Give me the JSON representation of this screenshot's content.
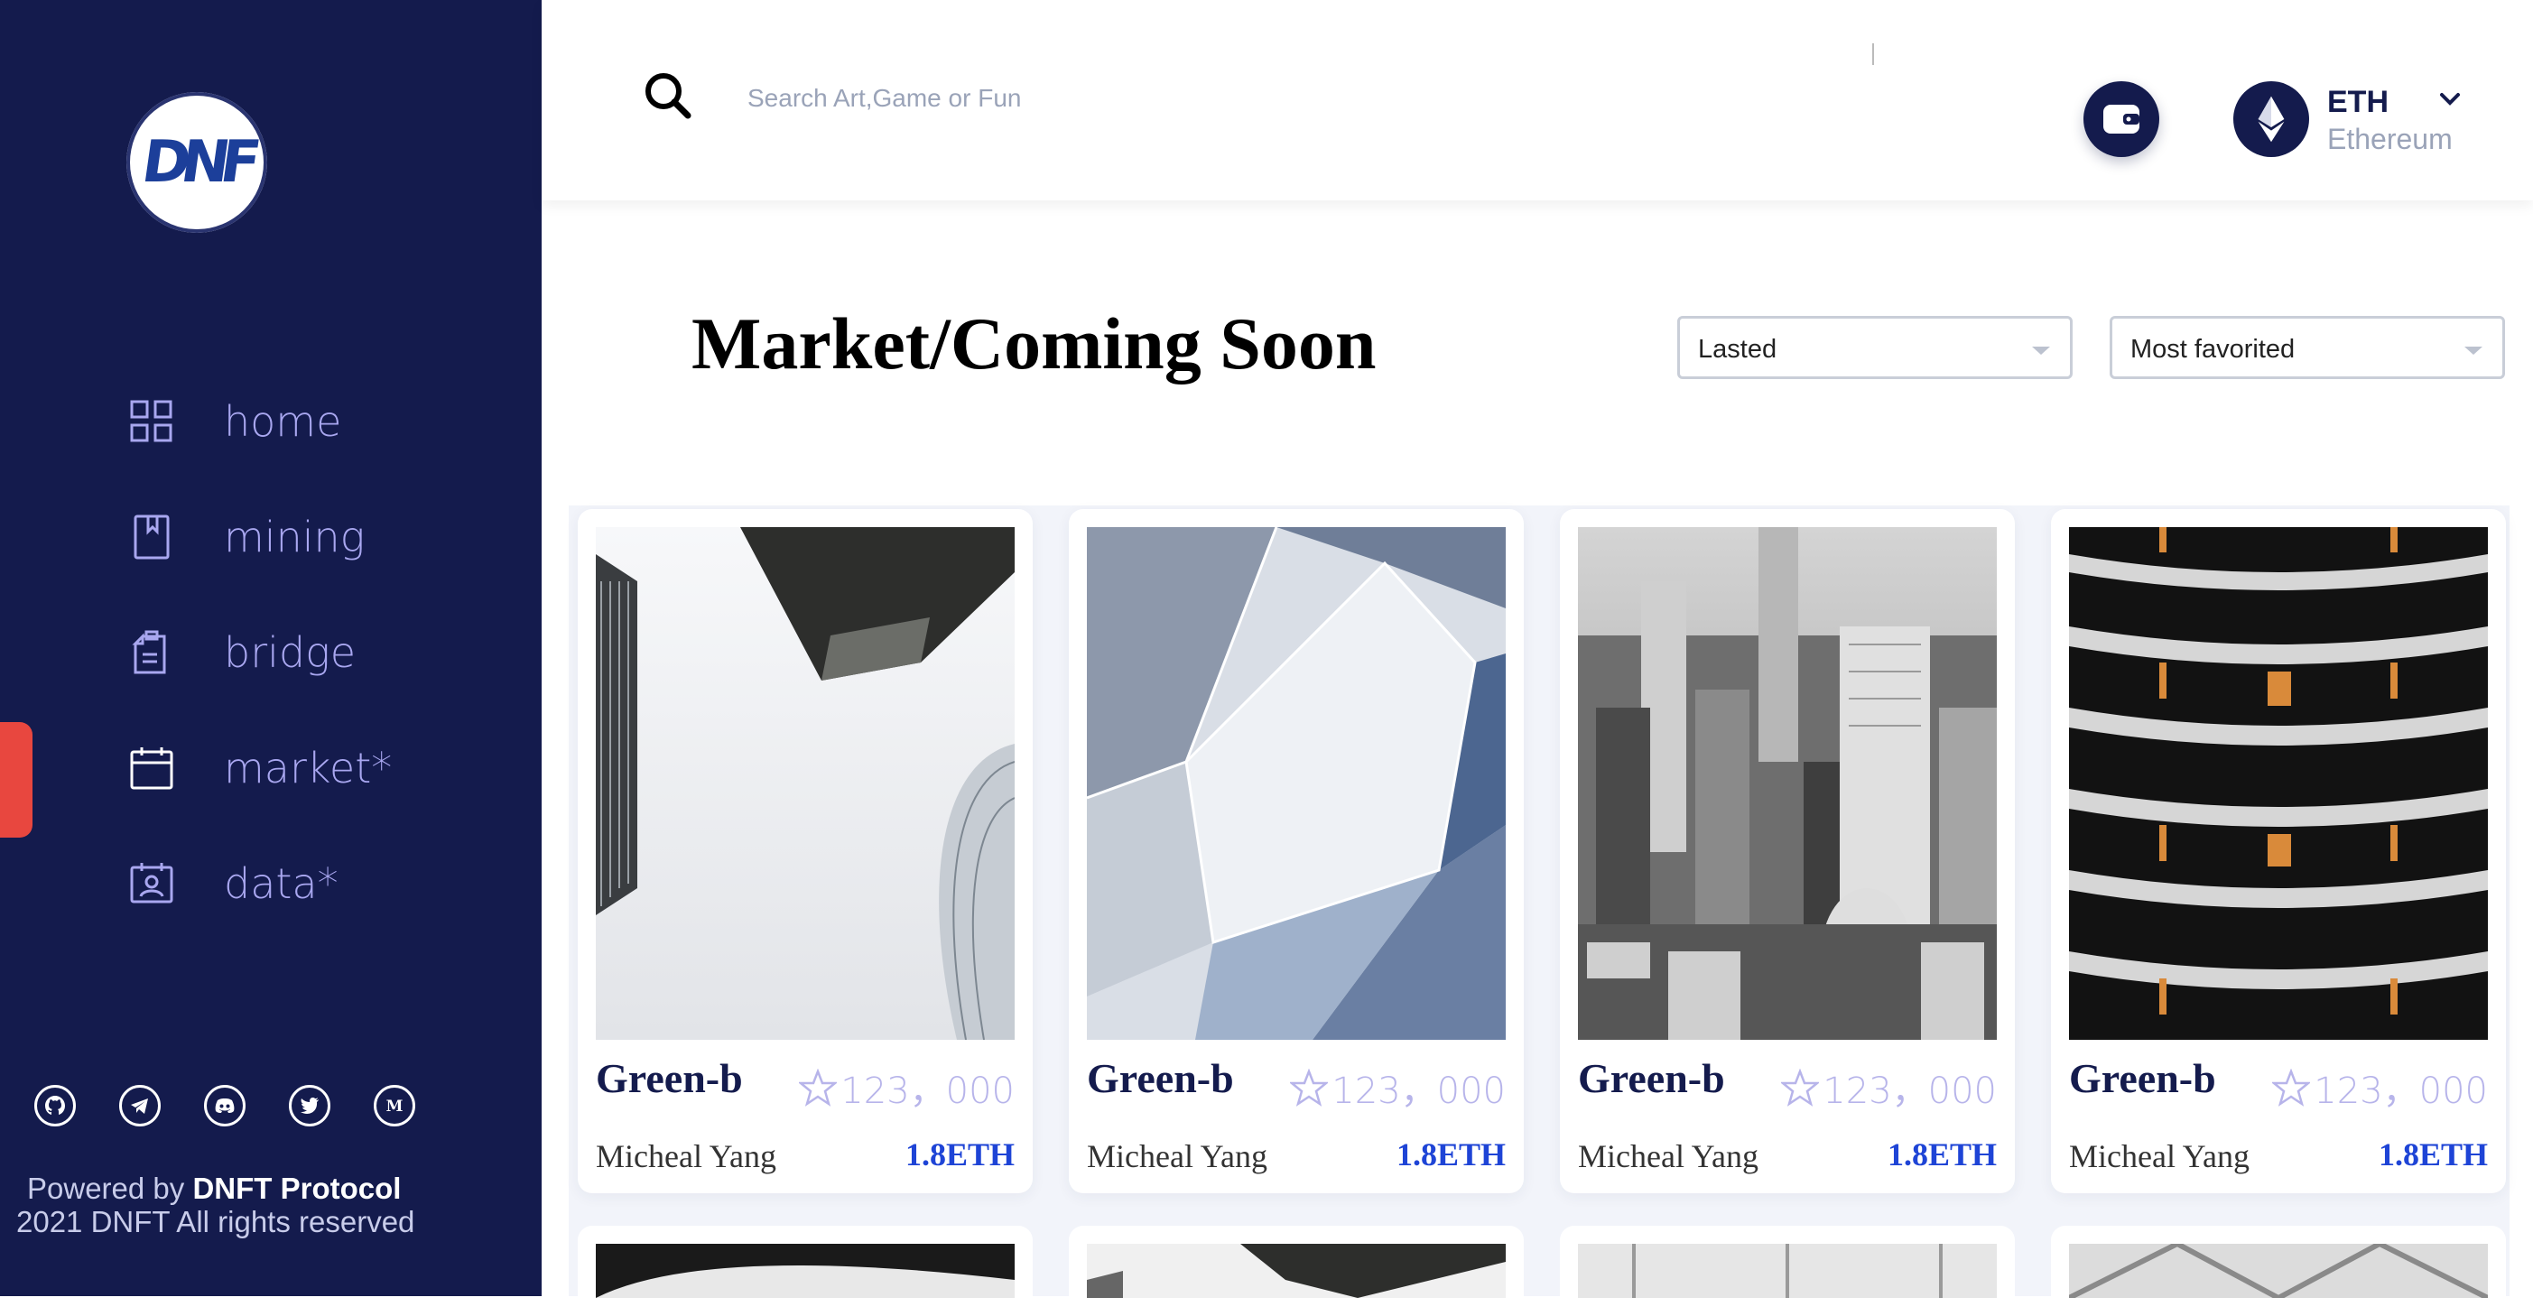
{
  "brand": {
    "logo_text": "DNF"
  },
  "sidebar": {
    "items": [
      {
        "label": "home",
        "icon": "grid-icon"
      },
      {
        "label": "mining",
        "icon": "bookmark-icon"
      },
      {
        "label": "bridge",
        "icon": "documents-icon"
      },
      {
        "label": "market*",
        "icon": "calendar-icon",
        "active": true
      },
      {
        "label": "data*",
        "icon": "id-card-icon"
      }
    ],
    "social": [
      "github-icon",
      "telegram-icon",
      "discord-icon",
      "twitter-icon",
      "medium-icon"
    ],
    "powered_prefix": "Powered by ",
    "powered_brand": "DNFT Protocol",
    "rights": "2021 DNFT All rights reserved"
  },
  "header": {
    "search_placeholder": "Search Art,Game or Fun",
    "network_symbol": "ETH",
    "network_name": "Ethereum"
  },
  "main": {
    "title": "Market/Coming Soon",
    "sort_select": "Lasted",
    "filter_select": "Most favorited",
    "cards": [
      {
        "name": "Green-b",
        "favorites": "123，000",
        "author": "Micheal Yang",
        "price": "1.8ETH"
      },
      {
        "name": "Green-b",
        "favorites": "123，000",
        "author": "Micheal Yang",
        "price": "1.8ETH"
      },
      {
        "name": "Green-b",
        "favorites": "123，000",
        "author": "Micheal Yang",
        "price": "1.8ETH"
      },
      {
        "name": "Green-b",
        "favorites": "123，000",
        "author": "Micheal Yang",
        "price": "1.8ETH"
      }
    ]
  },
  "colors": {
    "sidebar": "#141b4d",
    "accent": "#1e44d6",
    "active_marker": "#e8473f",
    "nav_text": "#a9a7f0"
  }
}
